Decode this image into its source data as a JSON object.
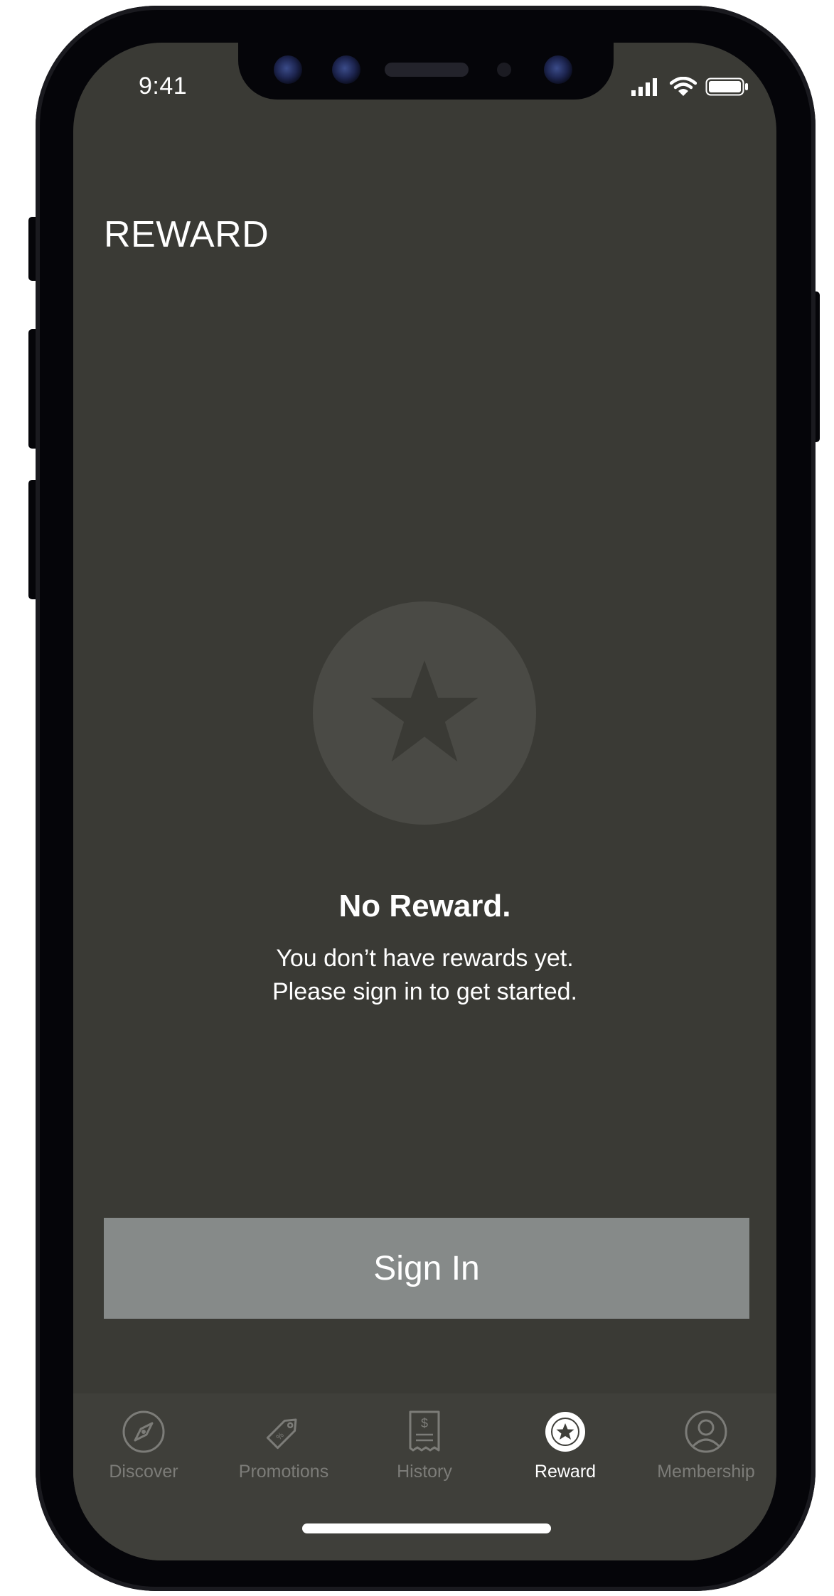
{
  "status_bar": {
    "time": "9:41"
  },
  "header": {
    "title": "REWARD"
  },
  "empty_state": {
    "icon": "star-icon",
    "title": "No Reward.",
    "line1": "You don’t have rewards yet.",
    "line2": "Please sign in to get started."
  },
  "actions": {
    "sign_in_label": "Sign In"
  },
  "tab_bar": {
    "active": "Reward",
    "items": [
      {
        "label": "Discover",
        "icon": "compass-icon"
      },
      {
        "label": "Promotions",
        "icon": "tag-icon"
      },
      {
        "label": "History",
        "icon": "receipt-icon"
      },
      {
        "label": "Reward",
        "icon": "star-badge-icon"
      },
      {
        "label": "Membership",
        "icon": "user-icon"
      }
    ]
  },
  "colors": {
    "screen_background": "#3a3a35",
    "tab_bar_background": "#3f3f3a",
    "button_background": "#868a89",
    "inactive_tab": "#7c7c78",
    "active_tab": "#ffffff",
    "empty_icon_circle": "#4a4a45"
  }
}
